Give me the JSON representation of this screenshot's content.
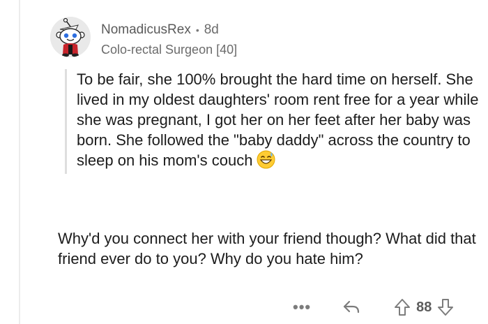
{
  "comment": {
    "username": "NomadicusRex",
    "separator": "•",
    "age": "8d",
    "flair": "Colo-rectal Surgeon [40]",
    "quote": "To be fair, she 100% brought the hard time on herself. She lived in my oldest daughters' room rent free for a year while she was pregnant, I got her on her feet after her baby was born. She followed the \"baby daddy\" across the country to sleep on his mom's couch",
    "body": "Why'd you connect her with your friend though? What did that friend ever do to you? Why do you hate him?"
  },
  "actions": {
    "more": "•••",
    "score": "88"
  },
  "icons": {
    "avatar": "reddit-snoo-avatar",
    "emoji": "grinning-sweat-emoji",
    "reply": "reply-arrow-icon",
    "upvote": "upvote-arrow-icon",
    "downvote": "downvote-arrow-icon"
  },
  "colors": {
    "text": "#1c1c1c",
    "meta": "#6b6b6b",
    "quote_bar": "#dedede",
    "icons": "#7c7c7c"
  }
}
